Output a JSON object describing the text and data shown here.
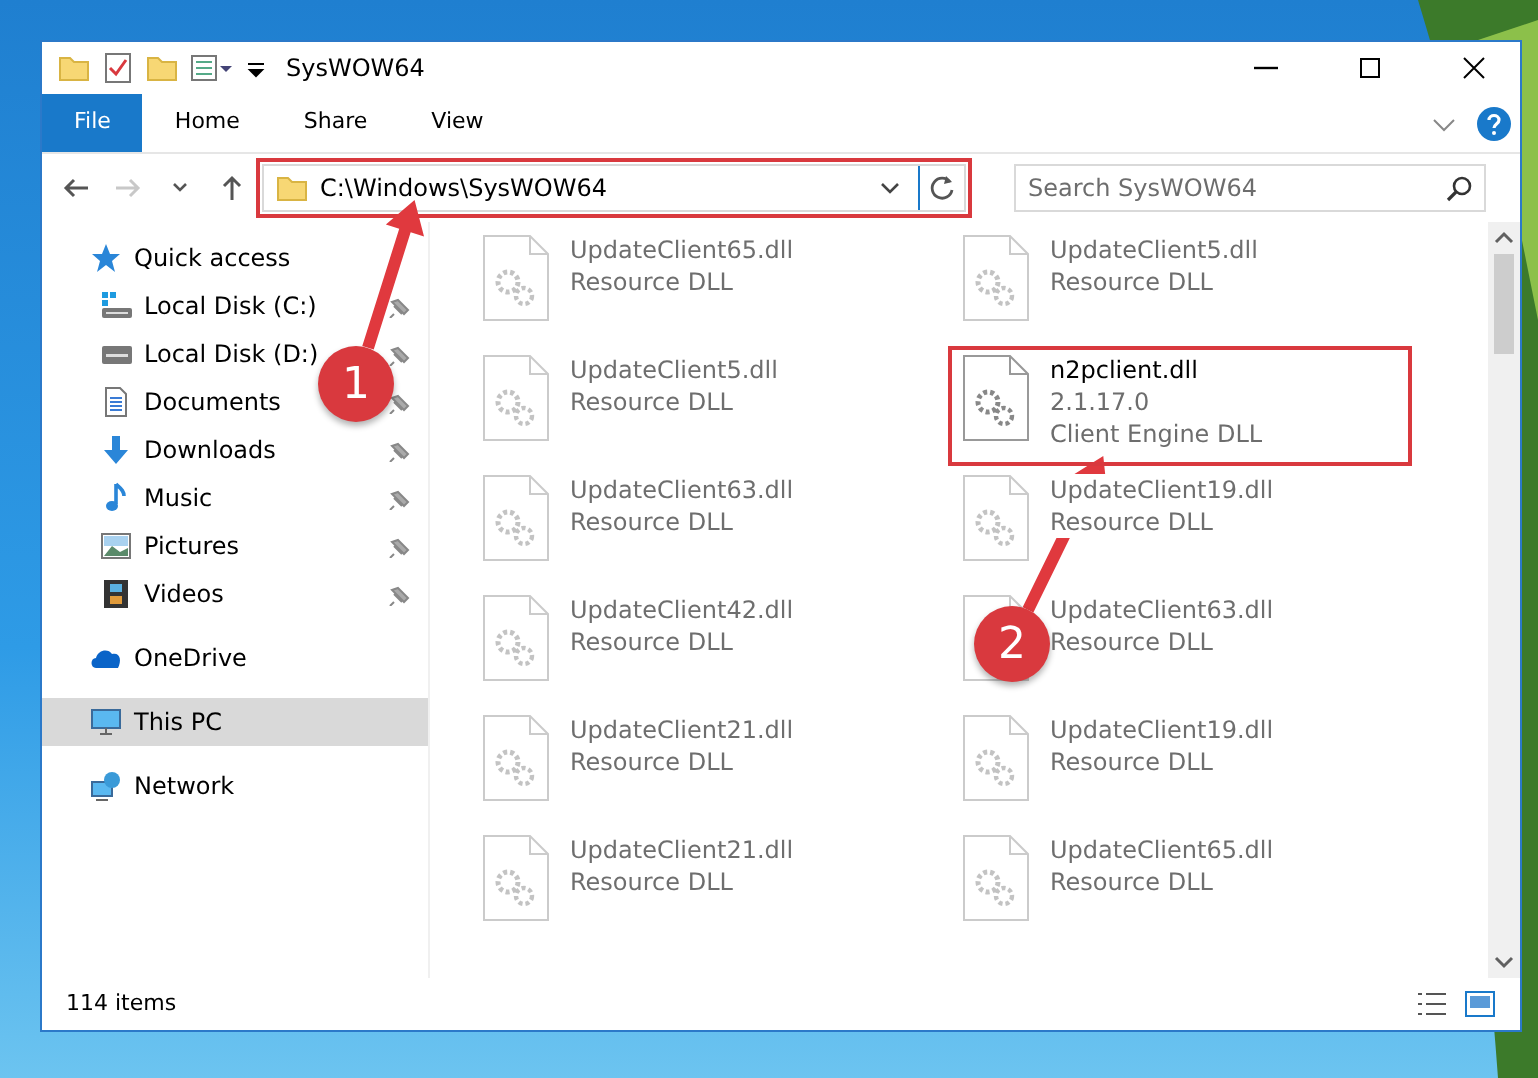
{
  "window": {
    "title": "SysWOW64"
  },
  "ribbon_tabs": [
    {
      "label": "File",
      "kind": "file_menu"
    },
    {
      "label": "Home",
      "kind": "tab"
    },
    {
      "label": "Share",
      "kind": "tab"
    },
    {
      "label": "View",
      "kind": "tab"
    }
  ],
  "nav_buttons": [
    {
      "kind": "back",
      "disabled": false
    },
    {
      "kind": "forward",
      "disabled": true
    },
    {
      "kind": "recent",
      "disabled": false
    },
    {
      "kind": "up",
      "disabled": false
    }
  ],
  "address_bar": {
    "path": "C:\\Windows\\SysWOW64",
    "highlighted": true
  },
  "search": {
    "placeholder": "Search SysWOW64"
  },
  "sidebar": {
    "items": [
      {
        "label": "Quick access",
        "kind": "star",
        "selected": false,
        "children": [
          {
            "label": "Local Disk (C:)",
            "kind": "system_drive",
            "pinned": true,
            "selected": false
          },
          {
            "label": "Local Disk (D:)",
            "kind": "drive",
            "pinned": true,
            "selected": false
          },
          {
            "label": "Documents",
            "kind": "documents",
            "pinned": true,
            "selected": false
          },
          {
            "label": "Downloads",
            "kind": "downloads",
            "pinned": true,
            "selected": false
          },
          {
            "label": "Music",
            "kind": "music",
            "pinned": true,
            "selected": false
          },
          {
            "label": "Pictures",
            "kind": "pictures",
            "pinned": true,
            "selected": false
          },
          {
            "label": "Videos",
            "kind": "videos",
            "pinned": true,
            "selected": false
          }
        ]
      },
      {
        "label": "OneDrive",
        "kind": "cloud",
        "selected": false
      },
      {
        "label": "This PC",
        "kind": "pc",
        "selected": true
      },
      {
        "label": "Network",
        "kind": "network",
        "selected": false
      }
    ]
  },
  "files": [
    {
      "name": "UpdateClient65.dll",
      "description": "Resource DLL",
      "faded": true,
      "highlighted": false
    },
    {
      "name": "UpdateClient5.dll",
      "description": "Resource DLL",
      "faded": true,
      "highlighted": false
    },
    {
      "name": "UpdateClient5.dll",
      "description": "Resource DLL",
      "faded": true,
      "highlighted": false
    },
    {
      "name": "n2pclient.dll",
      "version": "2.1.17.0",
      "description": "Client Engine DLL",
      "faded": false,
      "highlighted": true
    },
    {
      "name": "UpdateClient63.dll",
      "description": "Resource DLL",
      "faded": true,
      "highlighted": false
    },
    {
      "name": "UpdateClient19.dll",
      "description": "Resource DLL",
      "faded": true,
      "highlighted": false
    },
    {
      "name": "UpdateClient42.dll",
      "description": "Resource DLL",
      "faded": true,
      "highlighted": false
    },
    {
      "name": "UpdateClient63.dll",
      "description": "Resource DLL",
      "faded": true,
      "highlighted": false
    },
    {
      "name": "UpdateClient21.dll",
      "description": "Resource DLL",
      "faded": true,
      "highlighted": false
    },
    {
      "name": "UpdateClient19.dll",
      "description": "Resource DLL",
      "faded": true,
      "highlighted": false
    },
    {
      "name": "UpdateClient21.dll",
      "description": "Resource DLL",
      "faded": true,
      "highlighted": false
    },
    {
      "name": "UpdateClient65.dll",
      "description": "Resource DLL",
      "faded": true,
      "highlighted": false
    }
  ],
  "annotations": [
    {
      "label": "1"
    },
    {
      "label": "2"
    }
  ],
  "status_bar": {
    "item_count": "114 items"
  }
}
